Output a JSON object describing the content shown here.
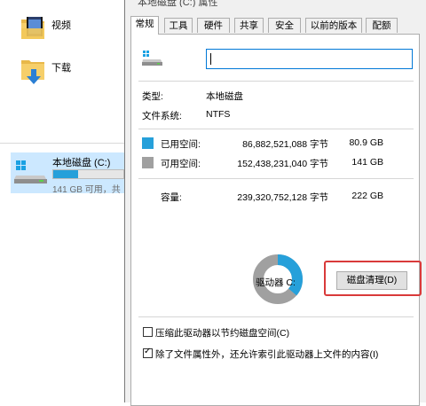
{
  "explorer": {
    "items": [
      {
        "label": "视频"
      },
      {
        "label": "下载"
      }
    ],
    "drive": {
      "name": "本地磁盘 (C:)",
      "sub": "141 GB 可用，共",
      "used_fraction": 0.36
    }
  },
  "dialog": {
    "title": "本地磁盘 (C:) 属性",
    "tabs": [
      "常规",
      "工具",
      "硬件",
      "共享",
      "安全",
      "以前的版本",
      "配额"
    ],
    "active_tab": 0,
    "name_value": "",
    "type_label": "类型:",
    "type_value": "本地磁盘",
    "fs_label": "文件系统:",
    "fs_value": "NTFS",
    "used_label": "已用空间:",
    "used_bytes": "86,882,521,088 字节",
    "used_gb": "80.9 GB",
    "free_label": "可用空间:",
    "free_bytes": "152,438,231,040 字节",
    "free_gb": "141 GB",
    "capacity_label": "容量:",
    "capacity_bytes": "239,320,752,128 字节",
    "capacity_gb": "222 GB",
    "drive_label": "驱动器 C:",
    "cleanup_button": "磁盘清理(D)",
    "compress_label": "压缩此驱动器以节约磁盘空间(C)",
    "compress_checked": false,
    "index_label": "除了文件属性外，还允许索引此驱动器上文件的内容(I)",
    "index_checked": true,
    "used_color": "#26a0da",
    "free_color": "#a0a0a0",
    "highlight_color": "#d93a3a",
    "used_fraction": 0.363
  }
}
